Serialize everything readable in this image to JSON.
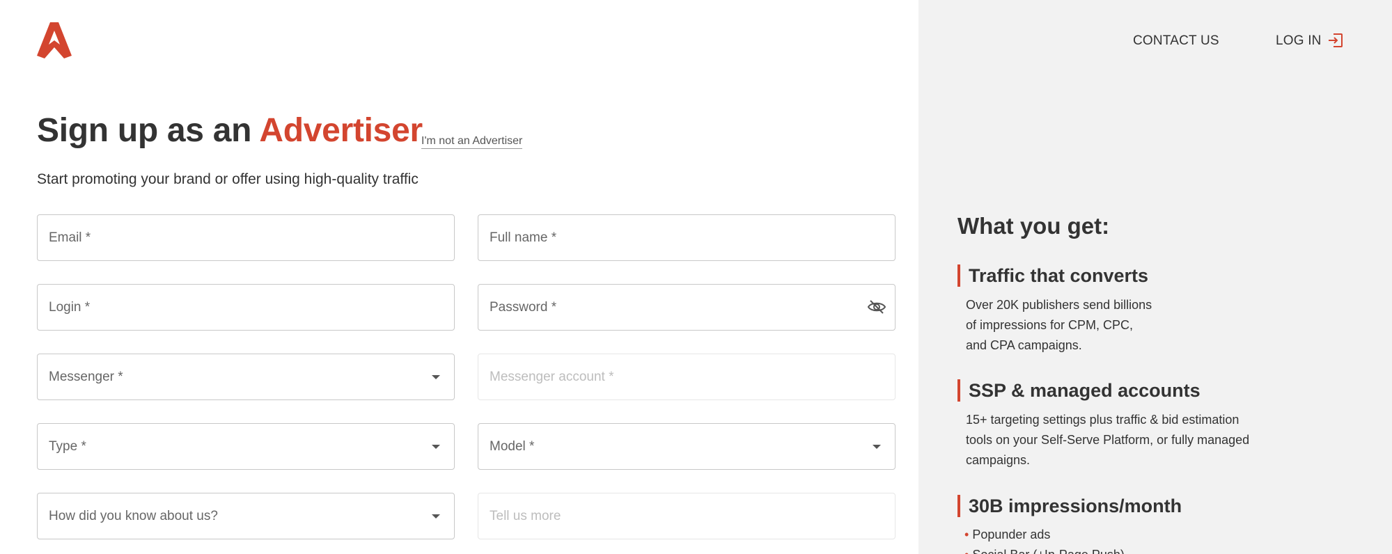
{
  "colors": {
    "accent": "#d3452f",
    "panel": "#f2f2f2",
    "text": "#333333"
  },
  "header": {
    "logo_icon": "brand-a-logo-icon",
    "contact_label": "CONTACT US",
    "login_label": "LOG IN",
    "login_icon": "log-in-icon"
  },
  "page": {
    "title_prefix": "Sign up as an ",
    "title_accent": "Advertiser",
    "not_advertiser_link": "I'm not an Advertiser",
    "subtitle": "Start promoting your brand or offer using high-quality traffic"
  },
  "form": {
    "email": "Email *",
    "full_name": "Full name *",
    "login": "Login *",
    "password": "Password *",
    "password_icon": "eye-off-icon",
    "messenger": "Messenger *",
    "messenger_account": "Messenger account *",
    "type": "Type *",
    "model": "Model *",
    "how_know": "How did you know about us?",
    "tell_more": "Tell us more"
  },
  "sidebar": {
    "heading": "What you get:",
    "features": [
      {
        "title": "Traffic that converts",
        "lines": [
          "Over 20K publishers send billions",
          "of impressions for CPM, CPC,",
          "and CPA campaigns."
        ]
      },
      {
        "title": "SSP & managed accounts",
        "lines": [
          "15+ targeting settings plus traffic & bid estimation",
          "tools on your Self-Serve Platform, or fully managed",
          "campaigns."
        ]
      },
      {
        "title": "30B impressions/month",
        "bullets": [
          "Popunder ads",
          "Social Bar (+In-Page Push)"
        ]
      }
    ]
  }
}
